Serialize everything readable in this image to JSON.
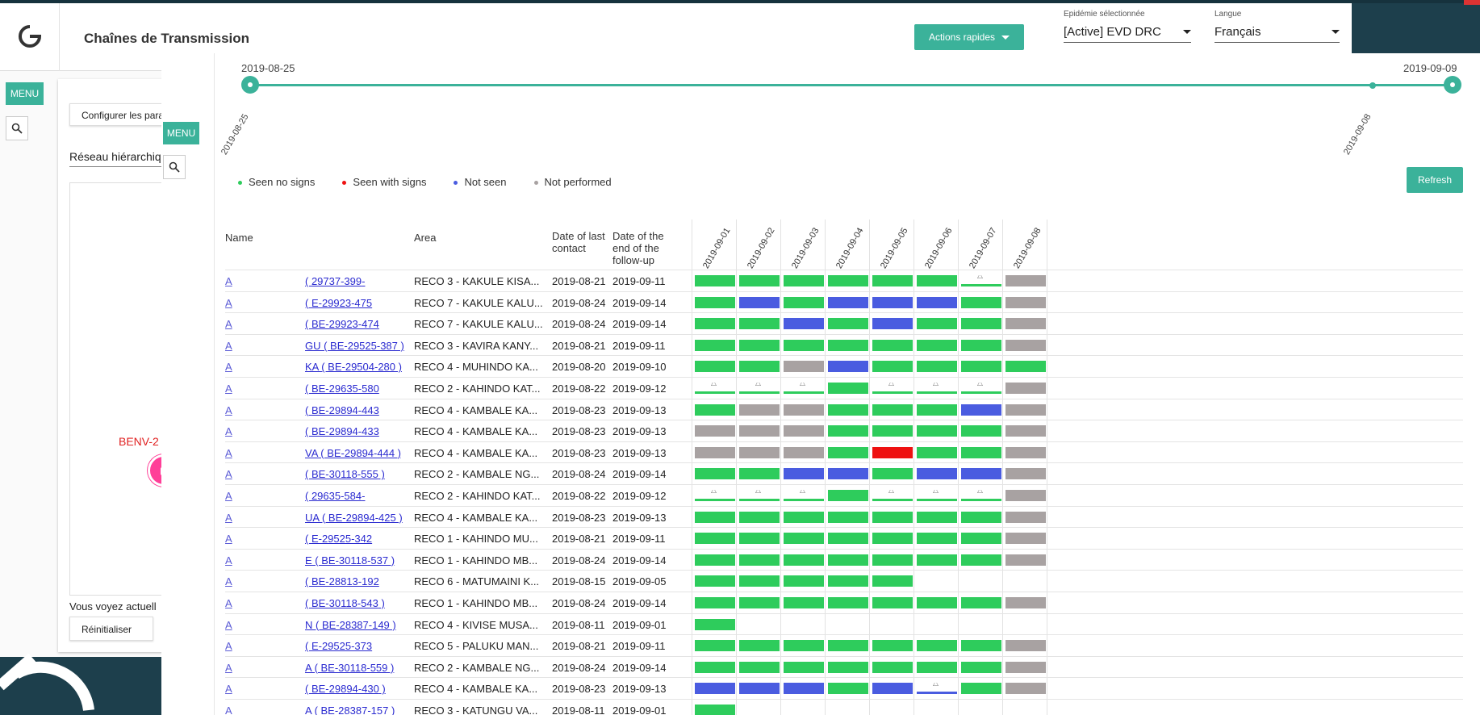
{
  "back": {
    "title": "Chaînes de Transmission",
    "quick_actions": "Actions rapides",
    "epidemic_label": "Epidémie sélectionnée",
    "epidemic_value": "[Active] EVD DRC",
    "language_label": "Langue",
    "language_value": "Français",
    "menu": "MENU",
    "configure": "Configurer les para",
    "network": "Réseau hiérarchiq",
    "node_label": "BENV-2",
    "viewing": "Vous voyez actuell",
    "reset": "Réinitialiser"
  },
  "front": {
    "menu": "MENU",
    "timeline": {
      "start": "2019-08-25",
      "end": "2019-09-09",
      "start_rot": "2019-08-25",
      "marker_rot": "2019-09-08"
    },
    "legend": [
      {
        "label": "Seen no signs",
        "color": "#2ecc5c"
      },
      {
        "label": "Seen with signs",
        "color": "#ee1111"
      },
      {
        "label": "Not seen",
        "color": "#4a5ce0"
      },
      {
        "label": "Not performed",
        "color": "#a8a2a2"
      }
    ],
    "refresh": "Refresh",
    "headers": {
      "name": "Name",
      "area": "Area",
      "last_contact": "Date of last contact",
      "end_followup": "Date of the end of the follow-up"
    },
    "date_columns": [
      "2019-09-01",
      "2019-09-02",
      "2019-09-03",
      "2019-09-04",
      "2019-09-05",
      "2019-09-06",
      "2019-09-07",
      "2019-09-08"
    ],
    "rows": [
      {
        "a": "A",
        "id": "-29737-399 )",
        "area": "RECO 3 - KAKULE KISA...",
        "last": "2019-08-21",
        "end": "2019-09-11",
        "s": [
          "green",
          "green",
          "green",
          "green",
          "green",
          "green",
          "ngreen",
          "grey"
        ]
      },
      {
        "a": "A",
        "id": "E-29923-475 )",
        "area": "RECO 7 - KAKULE KALU...",
        "last": "2019-08-24",
        "end": "2019-09-14",
        "s": [
          "green",
          "blue",
          "green",
          "blue",
          "blue",
          "blue",
          "green",
          "grey"
        ]
      },
      {
        "a": "A",
        "id": "BE-29923-474 )",
        "area": "RECO 7 - KAKULE KALU...",
        "last": "2019-08-24",
        "end": "2019-09-14",
        "s": [
          "green",
          "green",
          "blue",
          "green",
          "blue",
          "green",
          "green",
          "grey"
        ]
      },
      {
        "a": "A",
        "id": "GU ( BE-29525-387 )",
        "area": "RECO 3 - KAVIRA KANY...",
        "last": "2019-08-21",
        "end": "2019-09-11",
        "s": [
          "green",
          "green",
          "green",
          "green",
          "green",
          "green",
          "green",
          "grey"
        ]
      },
      {
        "a": "A",
        "id": "KA ( BE-29504-280 )",
        "area": "RECO 4 - MUHINDO KA...",
        "last": "2019-08-20",
        "end": "2019-09-10",
        "s": [
          "green",
          "green",
          "grey",
          "blue",
          "green",
          "green",
          "green",
          "green"
        ]
      },
      {
        "a": "A",
        "id": "BE-29635-580 )",
        "area": "RECO 2 - KAHINDO KAT...",
        "last": "2019-08-22",
        "end": "2019-09-12",
        "s": [
          "ngreen",
          "ngreen",
          "ngreen",
          "green",
          "ngreen",
          "ngreen",
          "ngreen",
          "grey"
        ]
      },
      {
        "a": "A",
        "id": "BE-29894-443 )",
        "area": "RECO 4 - KAMBALE KA...",
        "last": "2019-08-23",
        "end": "2019-09-13",
        "s": [
          "green",
          "grey",
          "grey",
          "green",
          "green",
          "green",
          "blue",
          "grey"
        ]
      },
      {
        "a": "A",
        "id": "BE-29894-433 )",
        "area": "RECO 4 - KAMBALE KA...",
        "last": "2019-08-23",
        "end": "2019-09-13",
        "s": [
          "grey",
          "grey",
          "grey",
          "green",
          "green",
          "green",
          "green",
          "grey"
        ]
      },
      {
        "a": "A",
        "id": "VA ( BE-29894-444 )",
        "area": "RECO 4 - KAMBALE KA...",
        "last": "2019-08-23",
        "end": "2019-09-13",
        "s": [
          "grey",
          "grey",
          "grey",
          "green",
          "red",
          "green",
          "green",
          "grey"
        ]
      },
      {
        "a": "A",
        "id": "( BE-30118-555 )",
        "area": "RECO 2 - KAMBALE NG...",
        "last": "2019-08-24",
        "end": "2019-09-14",
        "s": [
          "green",
          "green",
          "blue",
          "blue",
          "green",
          "blue",
          "blue",
          "grey"
        ]
      },
      {
        "a": "A",
        "id": "-29635-584 )",
        "area": "RECO 2 - KAHINDO KAT...",
        "last": "2019-08-22",
        "end": "2019-09-12",
        "s": [
          "ngreen",
          "ngreen",
          "ngreen",
          "green",
          "ngreen",
          "ngreen",
          "ngreen",
          "grey"
        ]
      },
      {
        "a": "A",
        "id": "UA ( BE-29894-425 )",
        "area": "RECO 4 - KAMBALE KA...",
        "last": "2019-08-23",
        "end": "2019-09-13",
        "s": [
          "green",
          "green",
          "green",
          "green",
          "green",
          "green",
          "green",
          "grey"
        ]
      },
      {
        "a": "A",
        "id": "E-29525-342 )",
        "area": "RECO 1 - KAHINDO MU...",
        "last": "2019-08-21",
        "end": "2019-09-11",
        "s": [
          "green",
          "green",
          "green",
          "green",
          "green",
          "green",
          "green",
          "grey"
        ]
      },
      {
        "a": "A",
        "id": "E ( BE-30118-537 )",
        "area": "RECO 1 - KAHINDO MB...",
        "last": "2019-08-24",
        "end": "2019-09-14",
        "s": [
          "green",
          "green",
          "green",
          "green",
          "green",
          "green",
          "green",
          "grey"
        ]
      },
      {
        "a": "A",
        "id": "BE-28813-192 )",
        "area": "RECO 6 - MATUMAINI K...",
        "last": "2019-08-15",
        "end": "2019-09-05",
        "s": [
          "green",
          "green",
          "green",
          "green",
          "green",
          "empty",
          "empty",
          "empty"
        ]
      },
      {
        "a": "A",
        "id": "( BE-30118-543 )",
        "area": "RECO 1 - KAHINDO MB...",
        "last": "2019-08-24",
        "end": "2019-09-14",
        "s": [
          "green",
          "green",
          "green",
          "green",
          "green",
          "green",
          "green",
          "grey"
        ]
      },
      {
        "a": "A",
        "id": "N ( BE-28387-149 )",
        "area": "RECO 4 - KIVISE MUSA...",
        "last": "2019-08-11",
        "end": "2019-09-01",
        "s": [
          "green",
          "empty",
          "empty",
          "empty",
          "empty",
          "empty",
          "empty",
          "empty"
        ]
      },
      {
        "a": "A",
        "id": "E-29525-373 )",
        "area": "RECO 5 - PALUKU MAN...",
        "last": "2019-08-21",
        "end": "2019-09-11",
        "s": [
          "green",
          "green",
          "green",
          "green",
          "green",
          "green",
          "green",
          "grey"
        ]
      },
      {
        "a": "A",
        "id": "A ( BE-30118-559 )",
        "area": "RECO 2 - KAMBALE NG...",
        "last": "2019-08-24",
        "end": "2019-09-14",
        "s": [
          "green",
          "green",
          "green",
          "green",
          "green",
          "green",
          "green",
          "grey"
        ]
      },
      {
        "a": "A",
        "id": "( BE-29894-430 )",
        "area": "RECO 4 - KAMBALE KA...",
        "last": "2019-08-23",
        "end": "2019-09-13",
        "s": [
          "blue",
          "blue",
          "blue",
          "green",
          "blue",
          "nblue",
          "green",
          "grey"
        ]
      },
      {
        "a": "A",
        "id": "A ( BE-28387-157 )",
        "area": "RECO 3 - KATUNGU VA...",
        "last": "2019-08-11",
        "end": "2019-09-01",
        "s": [
          "green",
          "empty",
          "empty",
          "empty",
          "empty",
          "empty",
          "empty",
          "empty"
        ]
      }
    ]
  }
}
